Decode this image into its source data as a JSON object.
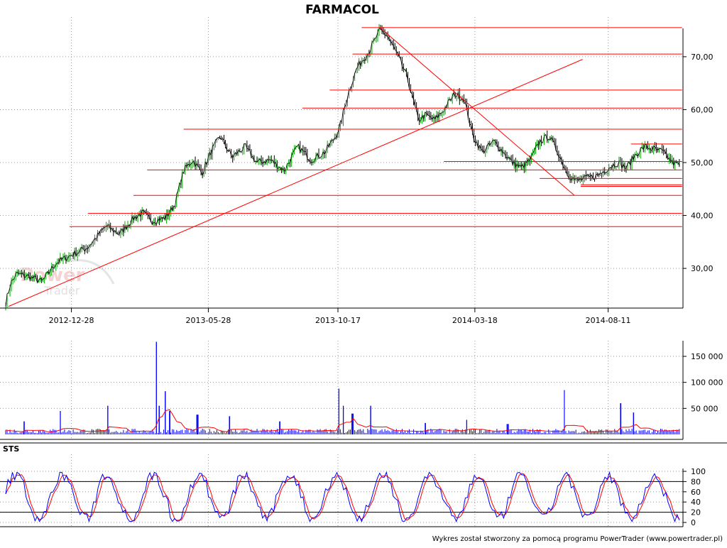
{
  "title": "FARMACOL",
  "footer": "Wykres został stworzony za pomocą programu PowerTrader (www.powertrader.pl)",
  "watermark": "PowerTrader",
  "colors": {
    "background": "#ffffff",
    "frame": "#000000",
    "grid": "#9a9a9a",
    "price": "#000000",
    "price_up": "#00aa00",
    "trendline": "#ff0000",
    "volume_bar": "#0000ff",
    "volume_avg": "#ff0000",
    "sts_k": "#0000ff",
    "sts_d": "#ff0000",
    "watermark": "#f0c8c8"
  },
  "chart_data": [
    {
      "type": "line",
      "title": "FARMACOL",
      "x_ticks": [
        "2012-12-28",
        "2013-05-28",
        "2013-10-17",
        "2014-03-18",
        "2014-08-11"
      ],
      "y_ticks": [
        "30,00",
        "40,00",
        "50,00",
        "60,00",
        "70,00"
      ],
      "ylim": [
        22.5,
        77.5
      ],
      "grid": true,
      "x_range_days": [
        0,
        650
      ],
      "x_tick_days": [
        72,
        222,
        364,
        514,
        660
      ],
      "price_keypoints": [
        [
          0,
          23.5
        ],
        [
          5,
          27
        ],
        [
          12,
          29
        ],
        [
          24,
          28.5
        ],
        [
          40,
          27.5
        ],
        [
          55,
          31
        ],
        [
          72,
          32.5
        ],
        [
          90,
          34
        ],
        [
          110,
          38
        ],
        [
          125,
          36.5
        ],
        [
          140,
          39.5
        ],
        [
          150,
          40.5
        ],
        [
          160,
          39
        ],
        [
          175,
          39.5
        ],
        [
          185,
          42
        ],
        [
          195,
          48.5
        ],
        [
          205,
          50.5
        ],
        [
          215,
          48
        ],
        [
          225,
          52
        ],
        [
          235,
          55
        ],
        [
          248,
          51
        ],
        [
          262,
          53
        ],
        [
          275,
          50
        ],
        [
          290,
          50.5
        ],
        [
          305,
          48.5
        ],
        [
          320,
          53
        ],
        [
          335,
          50.5
        ],
        [
          350,
          52
        ],
        [
          365,
          56
        ],
        [
          375,
          63
        ],
        [
          385,
          68
        ],
        [
          398,
          71
        ],
        [
          410,
          75
        ],
        [
          418,
          74
        ],
        [
          430,
          70
        ],
        [
          440,
          66
        ],
        [
          452,
          58
        ],
        [
          460,
          59
        ],
        [
          470,
          58
        ],
        [
          480,
          60
        ],
        [
          492,
          63
        ],
        [
          502,
          62
        ],
        [
          512,
          55
        ],
        [
          522,
          52
        ],
        [
          535,
          54
        ],
        [
          545,
          52
        ],
        [
          555,
          50
        ],
        [
          565,
          49
        ],
        [
          575,
          50.5
        ],
        [
          585,
          54
        ],
        [
          595,
          55
        ],
        [
          605,
          52
        ],
        [
          615,
          48
        ],
        [
          625,
          46.5
        ],
        [
          635,
          47
        ],
        [
          648,
          47.5
        ],
        [
          660,
          49
        ],
        [
          670,
          50
        ],
        [
          680,
          49
        ],
        [
          690,
          51.5
        ],
        [
          700,
          53
        ],
        [
          710,
          52.5
        ],
        [
          720,
          52
        ],
        [
          730,
          50
        ],
        [
          738,
          49.5
        ]
      ],
      "horizontal_lines": [
        {
          "value": 75.5,
          "from_day": 390,
          "to_day": 741
        },
        {
          "value": 70.5,
          "from_day": 380,
          "to_day": 741
        },
        {
          "value": 63.7,
          "from_day": 355,
          "to_day": 741
        },
        {
          "value": 60.3,
          "from_day": 325,
          "to_day": 741
        },
        {
          "value": 56.3,
          "from_day": 195,
          "to_day": 741
        },
        {
          "value": 53.5,
          "from_day": 685,
          "to_day": 741
        },
        {
          "value": 50.2,
          "from_day": 480,
          "to_day": 741
        },
        {
          "value": 48.6,
          "from_day": 155,
          "to_day": 741
        },
        {
          "value": 47.0,
          "from_day": 585,
          "to_day": 741
        },
        {
          "value": 45.8,
          "from_day": 630,
          "to_day": 741
        },
        {
          "value": 45.5,
          "from_day": 630,
          "to_day": 741
        },
        {
          "value": 43.8,
          "from_day": 140,
          "to_day": 741
        },
        {
          "value": 40.4,
          "from_day": 90,
          "to_day": 741
        },
        {
          "value": 37.9,
          "from_day": 70,
          "to_day": 741
        }
      ],
      "trend_lines": [
        {
          "from": [
            3,
            22.8
          ],
          "to": [
            632,
            69.5
          ]
        },
        {
          "from": [
            410,
            75.5
          ],
          "to": [
            623,
            43.8
          ]
        }
      ]
    },
    {
      "type": "bar",
      "title": "",
      "y_ticks": [
        "50 000",
        "100 000",
        "150 000"
      ],
      "ylim": [
        0,
        180000
      ],
      "grid": true,
      "spikes": [
        {
          "day": 165,
          "value": 178000
        },
        {
          "day": 175,
          "value": 83000
        },
        {
          "day": 168,
          "value": 55000
        },
        {
          "day": 180,
          "value": 45000
        },
        {
          "day": 60,
          "value": 45000
        },
        {
          "day": 112,
          "value": 55000
        },
        {
          "day": 210,
          "value": 38000
        },
        {
          "day": 245,
          "value": 35000
        },
        {
          "day": 365,
          "value": 88000
        },
        {
          "day": 370,
          "value": 55000
        },
        {
          "day": 400,
          "value": 55000
        },
        {
          "day": 380,
          "value": 40000
        },
        {
          "day": 505,
          "value": 28000
        },
        {
          "day": 612,
          "value": 85000
        },
        {
          "day": 674,
          "value": 60000
        },
        {
          "day": 688,
          "value": 42000
        },
        {
          "day": 20,
          "value": 25000
        },
        {
          "day": 300,
          "value": 25000
        },
        {
          "day": 460,
          "value": 22000
        },
        {
          "day": 550,
          "value": 20000
        }
      ]
    },
    {
      "type": "line",
      "title": "STS",
      "y_ticks": [
        "0",
        "20",
        "40",
        "60",
        "80",
        "100"
      ],
      "ylim": [
        0,
        100
      ],
      "levels": [
        20,
        80
      ],
      "grid": true,
      "series": [
        {
          "name": "",
          "role": "K"
        },
        {
          "name": "",
          "role": "D"
        }
      ]
    }
  ]
}
